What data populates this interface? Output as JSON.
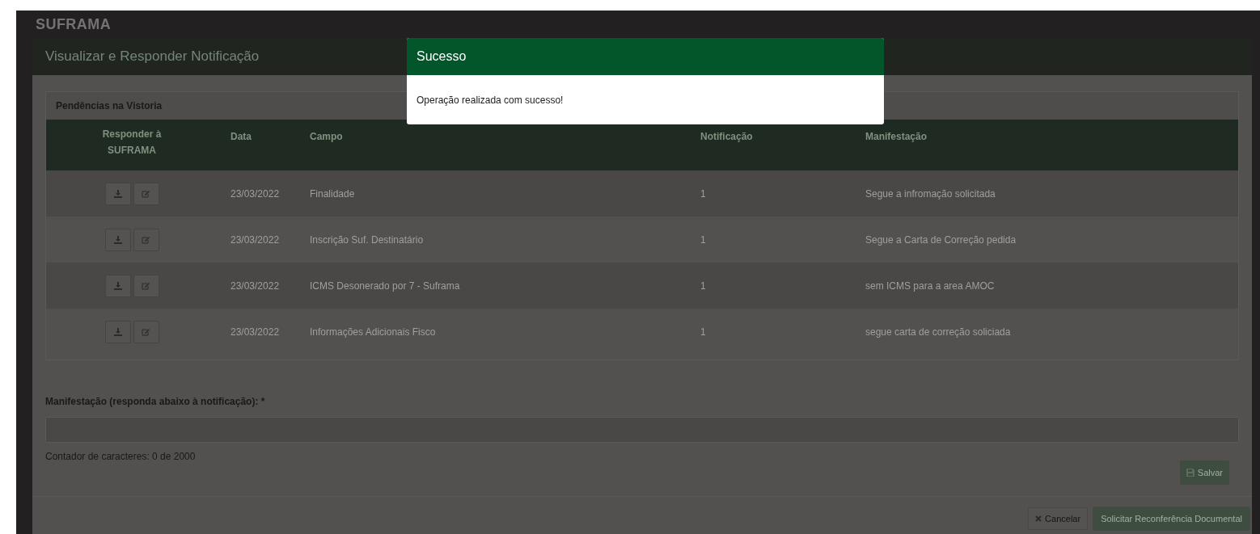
{
  "app_bar": {
    "logo": "SUFRAMA"
  },
  "modal": {
    "title": "Visualizar e Responder Notificação",
    "panel": {
      "title": "Pendências na Vistoria",
      "columns": [
        "Responder à SUFRAMA",
        "Data",
        "Campo",
        "Notificação",
        "Manifestação"
      ],
      "rows": [
        {
          "date": "23/03/2022",
          "field": "Finalidade",
          "notification": "1",
          "response": "Segue a infromação solicitada"
        },
        {
          "date": "23/03/2022",
          "field": "Inscrição Suf. Destinatário",
          "notification": "1",
          "response": "Segue a Carta de Correção pedida"
        },
        {
          "date": "23/03/2022",
          "field": "ICMS Desonerado por 7 - Suframa",
          "notification": "1",
          "response": "sem ICMS para a area AMOC"
        },
        {
          "date": "23/03/2022",
          "field": "Informações Adicionais Fisco",
          "notification": "1",
          "response": "segue carta de correção soliciada"
        }
      ]
    },
    "form": {
      "label": "Manifestação (responda abaixo à notificação): *",
      "counter": "Contador de caracteres: 0 de 2000",
      "save_button": "Salvar"
    },
    "footer": {
      "cancel_button": "Cancelar",
      "submit_button": "Solicitar Reconferência Documental"
    }
  },
  "dialog": {
    "title": "Sucesso",
    "message": "Operação realizada com sucesso!"
  }
}
